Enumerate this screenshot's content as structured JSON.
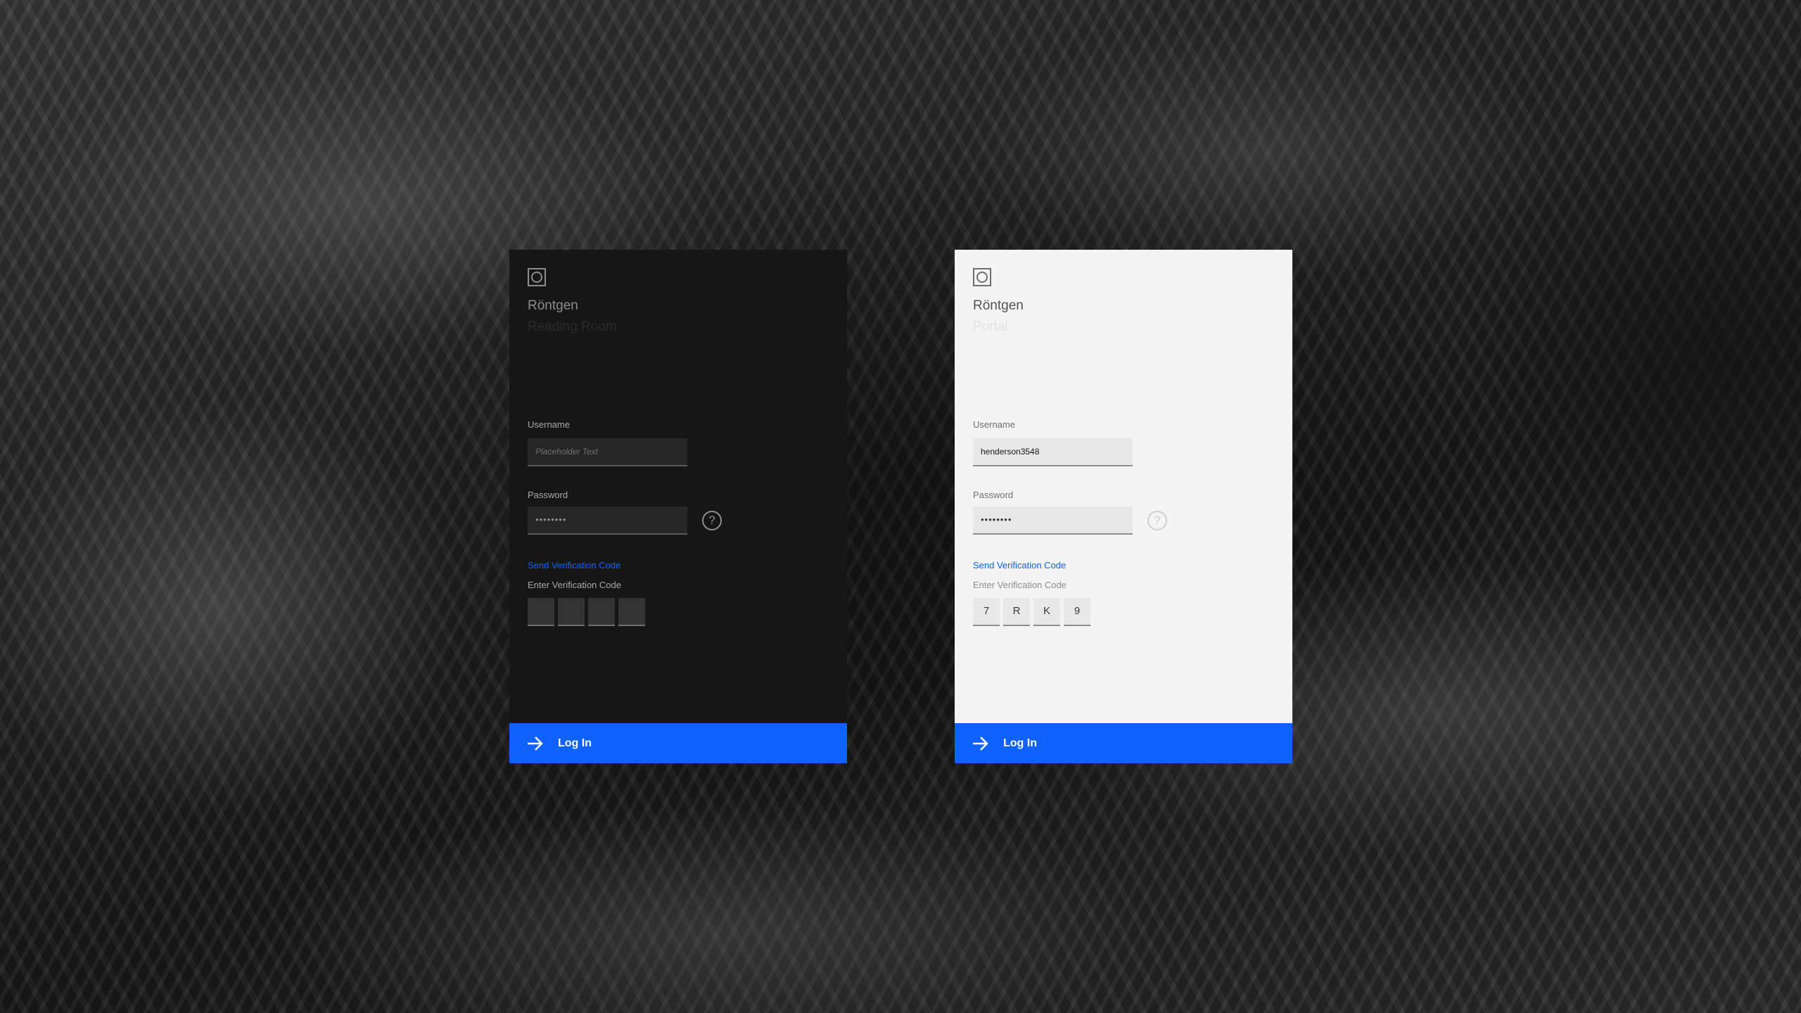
{
  "dark_card": {
    "brand": "Röntgen",
    "subtitle": "Reading Room",
    "username_label": "Username",
    "username_placeholder": "Placeholder Text",
    "username_value": "",
    "password_label": "Password",
    "password_value": "••••••••",
    "help_glyph": "?",
    "send_code_link": "Send Verification Code",
    "enter_code_label": "Enter Verification Code",
    "code_digits": [
      "",
      "",
      "",
      ""
    ],
    "login_label": "Log In"
  },
  "light_card": {
    "brand": "Röntgen",
    "subtitle": "Portal",
    "username_label": "Username",
    "username_value": "henderson3548",
    "password_label": "Password",
    "password_value": "••••••••",
    "help_glyph": "?",
    "send_code_link": "Send Verification Code",
    "enter_code_label": "Enter Verification Code",
    "code_digits": [
      "7",
      "R",
      "K",
      "9"
    ],
    "login_label": "Log In"
  },
  "icons": {
    "logo": "logo-icon",
    "help": "help-icon",
    "login_arrow": "arrow-right-icon"
  },
  "colors": {
    "accent": "#0f62fe",
    "dark_card_bg": "#161616",
    "light_card_bg": "#f4f4f4"
  }
}
